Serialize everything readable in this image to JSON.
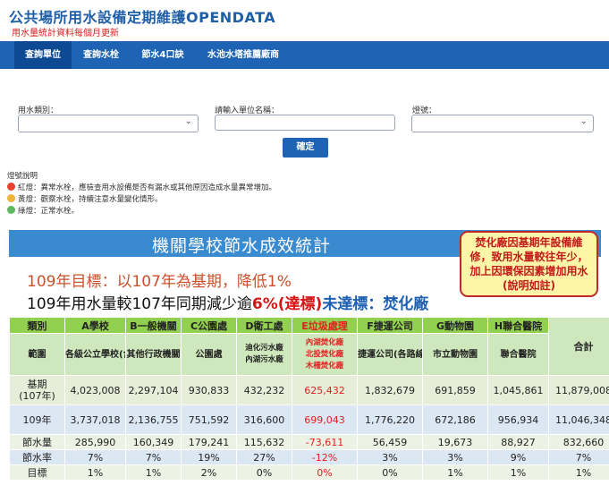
{
  "site": {
    "title": "公共場所用水設備定期維護OPENDATA",
    "subtitle": "用水量統計資料每個月更新"
  },
  "nav": [
    "查詢單位",
    "查詢水栓",
    "節水4口訣",
    "水池水塔推薦廠商"
  ],
  "form": {
    "category_label": "用水類別：",
    "unit_label": "請輸入單位名稱：",
    "light_label": "燈號：",
    "unit_value": "",
    "submit": "確定"
  },
  "legend": {
    "title": "燈號說明",
    "items": [
      {
        "color": "#e8422c",
        "text": "紅燈：異常水栓，應檢查用水設備是否有漏水或其他原因造成水量異常增加。"
      },
      {
        "color": "#f0b43a",
        "text": "黃燈：觀察水栓，持續注意水量變化情形。"
      },
      {
        "color": "#5cb85c",
        "text": "綠燈：正常水栓。"
      }
    ]
  },
  "report": {
    "banner": "機關學校節水成效統計",
    "callout": "焚化廠因基期年設備維修，致用水量較往年少，加上因環保因素增加用水(說明如註)",
    "target": "109年目標：以107年為基期，降低1%",
    "reduce_prefix": "109年用水量較107年同期減少逾",
    "reduce_pct": "6%(達標)",
    "reduce_mid": "未達標：",
    "reduce_unit": "焚化廠"
  },
  "table": {
    "header": [
      "類別",
      "A學校",
      "B一般機關",
      "C公園處",
      "D衛工處",
      "E垃圾處理",
      "F捷運公司",
      "G動物園",
      "H聯合醫院",
      "合計"
    ],
    "scope_label": "範圍",
    "scope": [
      "各級公立學校(含幼兒園)",
      "其他行政機關",
      "公園處",
      "迪化污水廠\n內湖污水廠",
      "內湖焚化廠\n北投焚化廠\n木柵焚化廠",
      "捷運公司(各路線)",
      "市立動物園",
      "聯合醫院",
      "合計"
    ],
    "rows": [
      {
        "label": "基期\n(107年)",
        "values": [
          "4,023,008",
          "2,297,104",
          "930,833",
          "432,232",
          "625,432",
          "1,832,679",
          "691,859",
          "1,045,861",
          "11,879,008"
        ]
      },
      {
        "label": "109年",
        "values": [
          "3,737,018",
          "2,136,755",
          "751,592",
          "316,600",
          "699,043",
          "1,776,220",
          "672,186",
          "956,934",
          "11,046,348"
        ]
      },
      {
        "label": "節水量",
        "values": [
          "285,990",
          "160,349",
          "179,241",
          "115,632",
          "-73,611",
          "56,459",
          "19,673",
          "88,927",
          "832,660"
        ]
      },
      {
        "label": "節水率",
        "values": [
          "7%",
          "7%",
          "19%",
          "27%",
          "-12%",
          "3%",
          "3%",
          "9%",
          "7%"
        ]
      },
      {
        "label": "目標",
        "values": [
          "1%",
          "1%",
          "2%",
          "0%",
          "0%",
          "0%",
          "1%",
          "1%",
          "1%"
        ]
      }
    ]
  }
}
